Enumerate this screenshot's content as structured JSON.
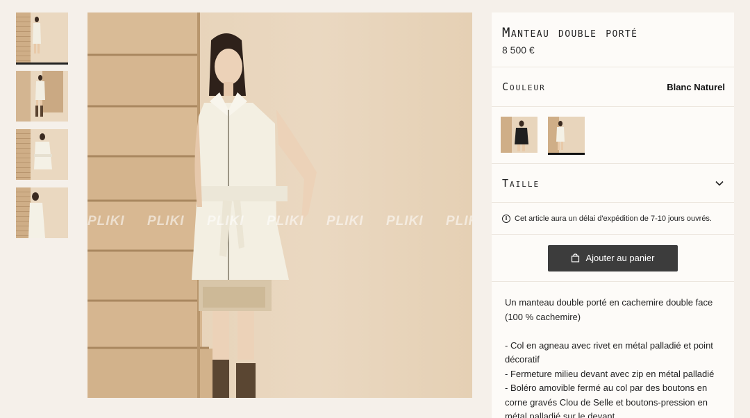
{
  "product": {
    "title": "Manteau double porté",
    "price": "8 500 €"
  },
  "color": {
    "label": "Couleur",
    "value": "Blanc Naturel",
    "swatches": [
      {
        "name": "black-variant",
        "active": false
      },
      {
        "name": "white-variant",
        "active": true
      }
    ]
  },
  "size": {
    "label": "Taille"
  },
  "notice": {
    "text": "Cet article aura un délai d'expédition de 7-10 jours ouvrés."
  },
  "cart": {
    "button_label": "Ajouter au panier"
  },
  "description": {
    "intro": "Un manteau double porté en cachemire double face (100 % cachemire)",
    "bullets": [
      "- Col en agneau avec rivet en métal palladié et point décoratif",
      "- Fermeture milieu devant avec zip en métal palladié",
      "- Boléro amovible fermé au col par des boutons en corne gravés Clou de Selle et boutons-pression en métal palladié sur le devant"
    ]
  },
  "watermark": [
    "PLIKI",
    "PLIKI",
    "PLIKI",
    "PLIKI",
    "PLIKI",
    "PLIKI",
    "PLIKI",
    "PLIKI"
  ],
  "icons": {
    "info": "info-icon",
    "bag": "shopping-bag-icon",
    "chevron": "chevron-down-icon"
  },
  "colors": {
    "accent": "#3c3c3c",
    "background": "#f5f0ea",
    "panel": "#fdfbf8"
  }
}
